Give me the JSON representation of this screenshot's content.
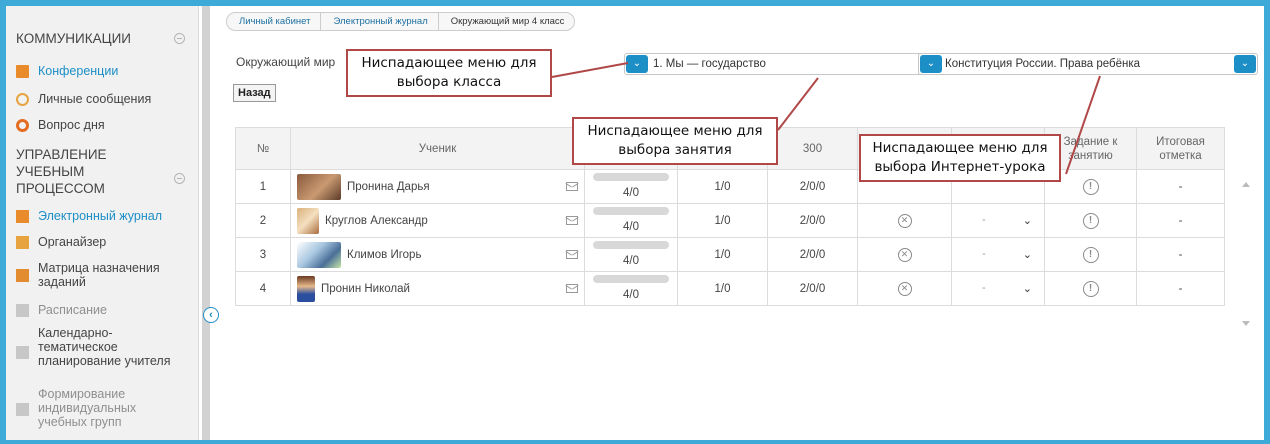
{
  "sidebar": {
    "section1": {
      "title": "КОММУНИКАЦИИ"
    },
    "section2": {
      "title": "УПРАВЛЕНИЕ УЧЕБНЫМ ПРОЦЕССОМ"
    },
    "items": [
      {
        "label": "Конференции"
      },
      {
        "label": "Личные сообщения"
      },
      {
        "label": "Вопрос дня"
      },
      {
        "label": "Электронный журнал"
      },
      {
        "label": "Органайзер"
      },
      {
        "label": "Матрица назначения заданий"
      },
      {
        "label": "Расписание"
      },
      {
        "label": "Календарно-тематическое планирование учителя"
      },
      {
        "label": "Формирование индивидуальных учебных групп"
      }
    ]
  },
  "breadcrumb": [
    "Личный кабинет",
    "Электронный журнал",
    "Окружающий мир 4 класс"
  ],
  "filters": {
    "subject_label": "Окружающий мир",
    "lesson_select": "1. Мы — государство",
    "topic_select": "Конституция России. Права ребёнка"
  },
  "back_button": "Назад",
  "table": {
    "headers": [
      "№",
      "Ученик",
      "",
      "",
      "300",
      "",
      "",
      "Задание к занятию",
      "Итоговая отметка"
    ],
    "rows": [
      {
        "num": "1",
        "name": "Пронина Дарья",
        "progress": "4/0",
        "c1": "1/0",
        "c2": "2/0/0",
        "final": "-"
      },
      {
        "num": "2",
        "name": "Круглов Александр",
        "progress": "4/0",
        "c1": "1/0",
        "c2": "2/0/0",
        "select": "-",
        "final": "-"
      },
      {
        "num": "3",
        "name": "Климов Игорь",
        "progress": "4/0",
        "c1": "1/0",
        "c2": "2/0/0",
        "select": "-",
        "final": "-"
      },
      {
        "num": "4",
        "name": "Пронин Николай",
        "progress": "4/0",
        "c1": "1/0",
        "c2": "2/0/0",
        "select": "-",
        "final": "-"
      }
    ]
  },
  "callouts": {
    "class": "Ниспадающее меню для выбора класса",
    "lesson": "Ниспадающее меню для выбора занятия",
    "internet": "Ниспадающее меню для выбора  Интернет-урока"
  },
  "colors": {
    "accent": "#1c8fc7",
    "frame": "#3eaad8",
    "callout_border": "#b04848"
  }
}
